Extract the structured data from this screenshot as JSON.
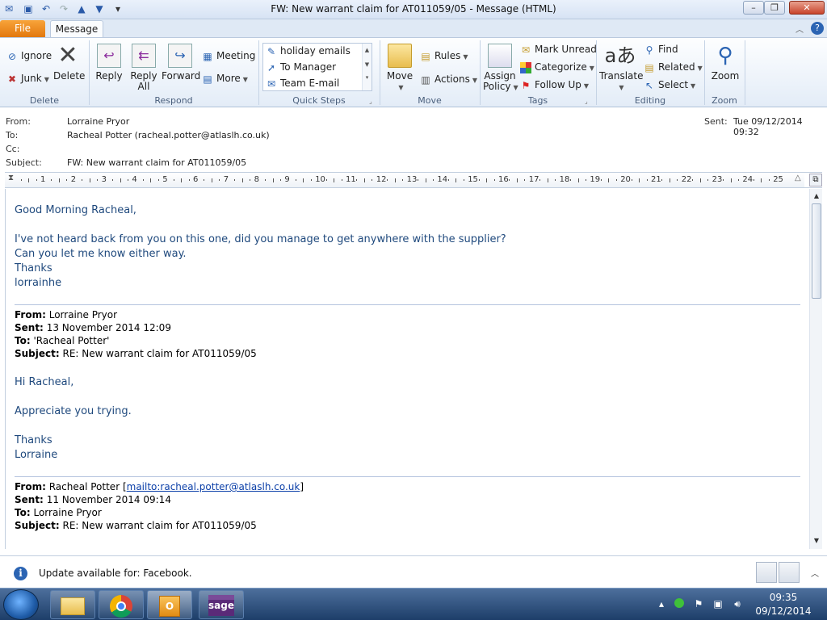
{
  "window": {
    "title": "FW: New warrant claim for AT011059/05  -  Message (HTML)",
    "qat_icons": [
      "mail-icon",
      "save-icon",
      "undo-icon",
      "redo-icon",
      "up-arrow-icon",
      "down-arrow-icon",
      "customize-icon"
    ]
  },
  "tabs": {
    "file": "File",
    "message": "Message"
  },
  "ribbon": {
    "delete_group": {
      "label": "Delete",
      "ignore": "Ignore",
      "junk": "Junk",
      "delete": "Delete"
    },
    "respond_group": {
      "label": "Respond",
      "reply": "Reply",
      "reply_all_1": "Reply",
      "reply_all_2": "All",
      "forward": "Forward",
      "meeting": "Meeting",
      "more": "More"
    },
    "quick_steps": {
      "label": "Quick Steps",
      "items": [
        "holiday emails",
        "To Manager",
        "Team E-mail"
      ]
    },
    "move_group": {
      "label": "Move",
      "move": "Move",
      "rules": "Rules",
      "actions": "Actions"
    },
    "tags_group": {
      "label": "Tags",
      "assign_1": "Assign",
      "assign_2": "Policy",
      "mark_unread": "Mark Unread",
      "categorize": "Categorize",
      "follow_up": "Follow Up"
    },
    "editing_group": {
      "label": "Editing",
      "translate": "Translate",
      "find": "Find",
      "related": "Related",
      "select": "Select"
    },
    "zoom_group": {
      "label": "Zoom",
      "zoom": "Zoom"
    }
  },
  "header": {
    "from_label": "From:",
    "from": "Lorraine Pryor",
    "to_label": "To:",
    "to": "Racheal Potter (racheal.potter@atlaslh.co.uk)",
    "cc_label": "Cc:",
    "subject_label": "Subject:",
    "subject": "FW: New warrant claim for AT011059/05",
    "sent_label": "Sent:",
    "sent": "Tue 09/12/2014 09:32"
  },
  "ruler": {
    "numbers": [
      "1",
      "2",
      "3",
      "4",
      "5",
      "6",
      "7",
      "8",
      "9",
      "10",
      "11",
      "12",
      "13",
      "14",
      "15",
      "16",
      "17",
      "18",
      "19",
      "20",
      "21",
      "22",
      "23",
      "24",
      "25"
    ]
  },
  "message": {
    "greeting": "Good Morning Racheal,",
    "line1": "I've not heard back from you on this one, did you manage to get anywhere with the supplier?",
    "line2": "Can you let me know either way.",
    "thanks": "Thanks",
    "signature": "lorrainhe",
    "quote1": {
      "from_label": "From:",
      "from": "Lorraine Pryor",
      "sent_label": "Sent:",
      "sent": "13 November 2014 12:09",
      "to_label": "To:",
      "to": "'Racheal Potter'",
      "subject_label": "Subject:",
      "subject": "RE: New warrant claim for AT011059/05",
      "greeting": "Hi Racheal,",
      "body": "Appreciate you trying.",
      "thanks": "Thanks",
      "signature": "Lorraine"
    },
    "quote2": {
      "from_label": "From:",
      "from": "Racheal Potter [",
      "mailto": "mailto:racheal.potter@atlaslh.co.uk",
      "from_end": "]",
      "sent_label": "Sent:",
      "sent": "11 November 2014 09:14",
      "to_label": "To:",
      "to": "Lorraine Pryor",
      "subject_label": "Subject:",
      "subject": "RE: New warrant claim for AT011059/05"
    }
  },
  "infobar": {
    "text": "Update available for: Facebook."
  },
  "taskbar": {
    "apps": [
      "explorer-icon",
      "chrome-icon",
      "outlook-icon",
      "sage-icon"
    ],
    "sage_label": "sage",
    "time": "09:35",
    "date": "09/12/2014"
  },
  "colors": {
    "accent_file_tab": "#e2780e",
    "body_text": "#1f497d",
    "taskbar": "#1d3e69"
  }
}
